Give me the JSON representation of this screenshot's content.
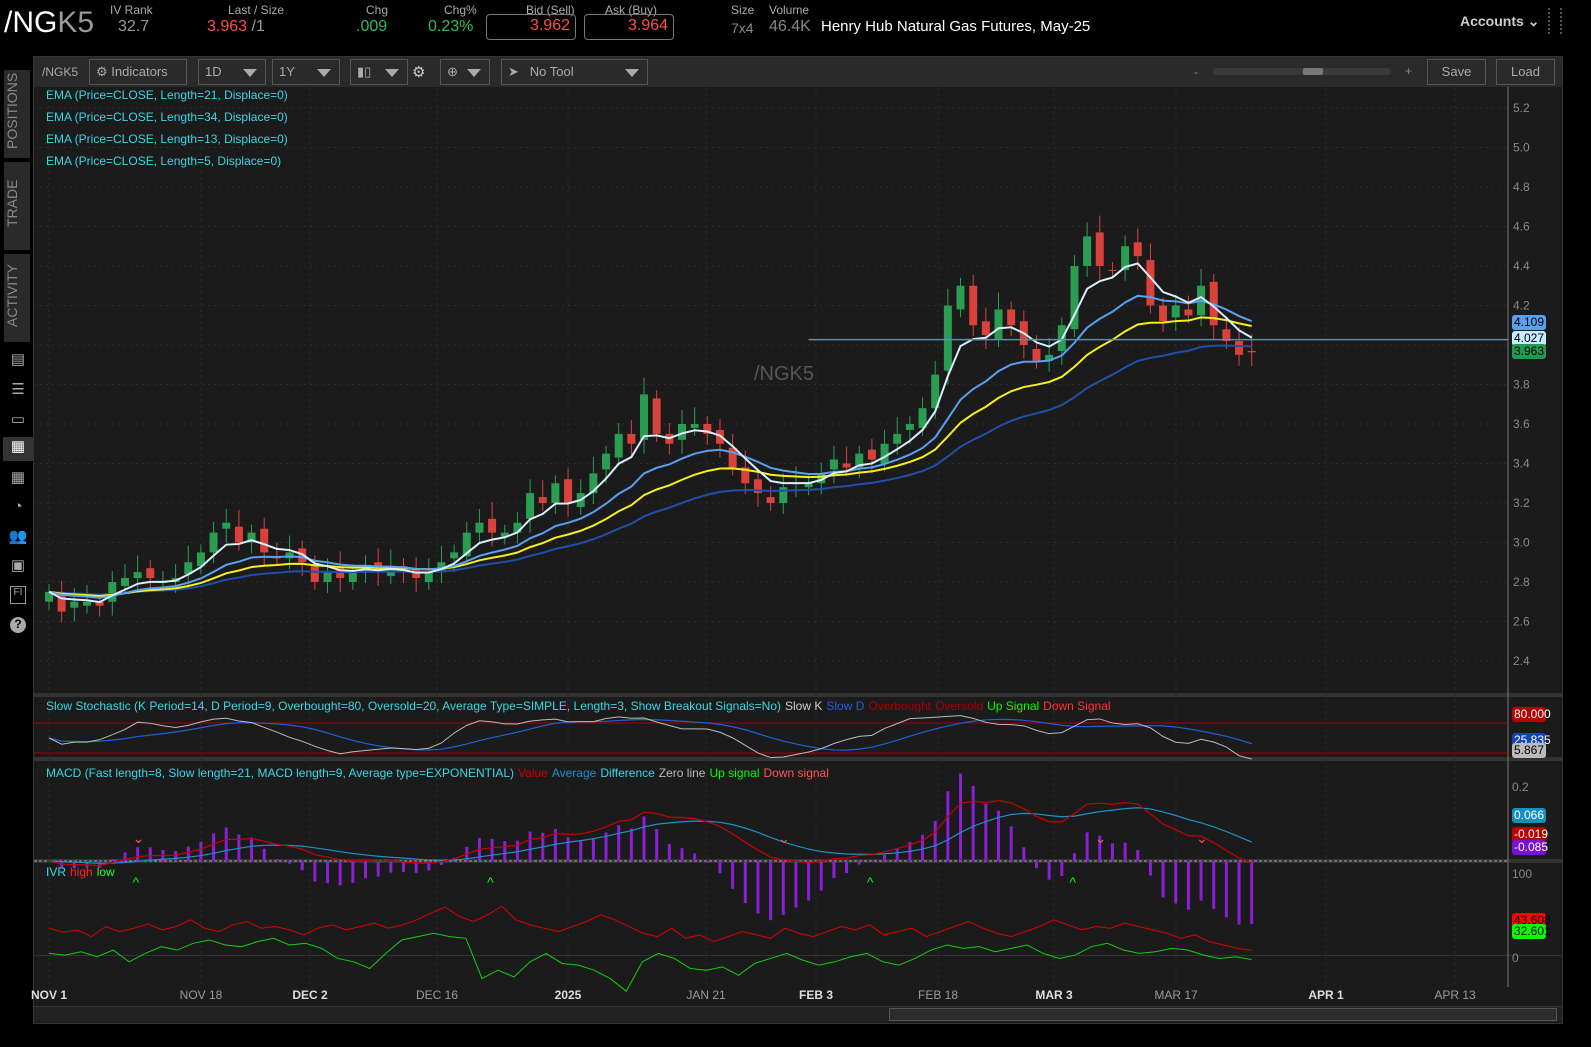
{
  "header": {
    "symbol_prefix": "/NG",
    "symbol_suffix": "K5",
    "iv_rank_label": "IV Rank",
    "iv_rank": "32.7",
    "last_label": "Last / Size",
    "last": "3.963",
    "size": "/1",
    "chg_label": "Chg",
    "chg": ".009",
    "chgpct_label": "Chg%",
    "chgpct": "0.23%",
    "bid_label": "Bid (Sell)",
    "bid": "3.962",
    "ask_label": "Ask (Buy)",
    "ask": "3.964",
    "size_label": "Size",
    "size_val": "7x4",
    "volume_label": "Volume",
    "volume": "46.4K",
    "description": "Henry Hub Natural Gas Futures, May-25",
    "accounts": "Accounts"
  },
  "sidebar": {
    "tabs": [
      "POSITIONS",
      "TRADE",
      "ACTIVITY"
    ]
  },
  "toolbar": {
    "symbol": "/NGK5",
    "indicators": "Indicators",
    "aggregation": "1D",
    "range": "1Y",
    "tool": "No Tool",
    "zoom_minus": "-",
    "zoom_plus": "+",
    "save": "Save",
    "load": "Load",
    "zoom_level": 0.55
  },
  "studies": {
    "ema": [
      "EMA (Price=CLOSE, Length=21, Displace=0)",
      "EMA (Price=CLOSE, Length=34, Displace=0)",
      "EMA (Price=CLOSE, Length=13, Displace=0)",
      "EMA (Price=CLOSE, Length=5, Displace=0)"
    ],
    "stoch": {
      "title": "Slow Stochastic (K Period=14, D Period=9, Overbought=80, Oversold=20, Average Type=SIMPLE, Length=3, Show Breakout Signals=No)",
      "legend": [
        "Slow K",
        "Slow D",
        "Overbought",
        "Oversold",
        "Up Signal",
        "Down Signal"
      ],
      "tags": [
        "80.000",
        "25.835",
        "5.867"
      ]
    },
    "macd": {
      "title": "MACD (Fast length=8, Slow length=21, MACD length=9, Average type=EXPONENTIAL)",
      "legend": [
        "Value",
        "Average",
        "Difference",
        "Zero line",
        "Up signal",
        "Down signal"
      ],
      "tick": "0.2",
      "tags": [
        "0.066",
        "-0.019",
        "-0.085"
      ]
    },
    "ivr": {
      "title": "IVR",
      "legend": [
        "high",
        "low"
      ],
      "ticks": [
        "100",
        "0"
      ],
      "tags": [
        "43.608",
        "32.601"
      ]
    }
  },
  "watermark": "/NGK5",
  "price_tags": [
    "4.109",
    "4.027",
    "3.963"
  ],
  "chart_data": {
    "type": "candlestick",
    "symbol": "/NGK5",
    "ylim": [
      2.3,
      5.3
    ],
    "y_ticks": [
      "5.2",
      "5.0",
      "4.8",
      "4.6",
      "4.4",
      "4.2",
      "4.0",
      "3.8",
      "3.6",
      "3.4",
      "3.2",
      "3.0",
      "2.8",
      "2.6",
      "2.4"
    ],
    "x_labels": [
      "NOV 1",
      "NOV 18",
      "DEC 2",
      "DEC 16",
      "2025",
      "JAN 21",
      "FEB 3",
      "FEB 18",
      "MAR 3",
      "MAR 17",
      "APR 1",
      "APR 13"
    ],
    "close": [
      2.75,
      2.65,
      2.7,
      2.7,
      2.68,
      2.8,
      2.82,
      2.85,
      2.82,
      2.8,
      2.82,
      2.9,
      2.95,
      3.05,
      3.1,
      3.0,
      3.05,
      2.95,
      2.92,
      2.95,
      2.9,
      2.8,
      2.85,
      2.82,
      2.85,
      2.88,
      2.85,
      2.88,
      2.85,
      2.82,
      2.85,
      2.9,
      2.95,
      3.05,
      3.1,
      3.05,
      3.05,
      3.1,
      3.25,
      3.2,
      3.3,
      3.2,
      3.25,
      3.35,
      3.45,
      3.55,
      3.5,
      3.75,
      3.55,
      3.5,
      3.6,
      3.6,
      3.55,
      3.5,
      3.38,
      3.3,
      3.25,
      3.2,
      3.28,
      3.3,
      3.3,
      3.35,
      3.42,
      3.38,
      3.45,
      3.42,
      3.5,
      3.55,
      3.6,
      3.68,
      3.85,
      4.2,
      4.3,
      4.1,
      4.05,
      4.18,
      4.1,
      4.0,
      3.92,
      3.95,
      4.1,
      4.4,
      4.55,
      4.4,
      4.38,
      4.5,
      4.45,
      4.2,
      4.12,
      4.2,
      4.15,
      4.3,
      4.1,
      4.02,
      3.95,
      3.963
    ],
    "ivr_high": [
      70,
      65,
      68,
      60,
      72,
      66,
      70,
      75,
      68,
      72,
      80,
      70,
      66,
      74,
      78,
      70,
      72,
      68,
      62,
      70,
      74,
      68,
      72,
      76,
      70,
      74,
      80,
      88,
      95,
      84,
      78,
      86,
      96,
      80,
      74,
      70,
      66,
      72,
      78,
      86,
      80,
      72,
      64,
      60,
      70,
      58,
      62,
      54,
      60,
      66,
      62,
      58,
      70,
      64,
      60,
      66,
      72,
      68,
      74,
      62,
      66,
      70,
      60,
      66,
      72,
      78,
      70,
      64,
      60,
      66,
      72,
      80,
      74,
      68,
      72,
      70,
      76,
      72,
      68,
      64,
      58,
      62,
      54,
      50,
      46,
      43.6
    ],
    "ivr_low": [
      40,
      38,
      42,
      36,
      44,
      30,
      40,
      48,
      44,
      52,
      56,
      50,
      48,
      54,
      58,
      50,
      52,
      46,
      34,
      30,
      22,
      40,
      56,
      60,
      64,
      60,
      58,
      10,
      20,
      12,
      30,
      40,
      28,
      26,
      20,
      10,
      -5,
      30,
      40,
      34,
      22,
      20,
      24,
      14,
      28,
      34,
      40,
      32,
      26,
      30,
      36,
      40,
      30,
      26,
      34,
      44,
      50,
      46,
      48,
      42,
      46,
      50,
      40,
      34,
      38,
      48,
      52,
      44,
      40,
      42,
      46,
      44,
      38,
      34,
      36,
      32.6
    ]
  }
}
